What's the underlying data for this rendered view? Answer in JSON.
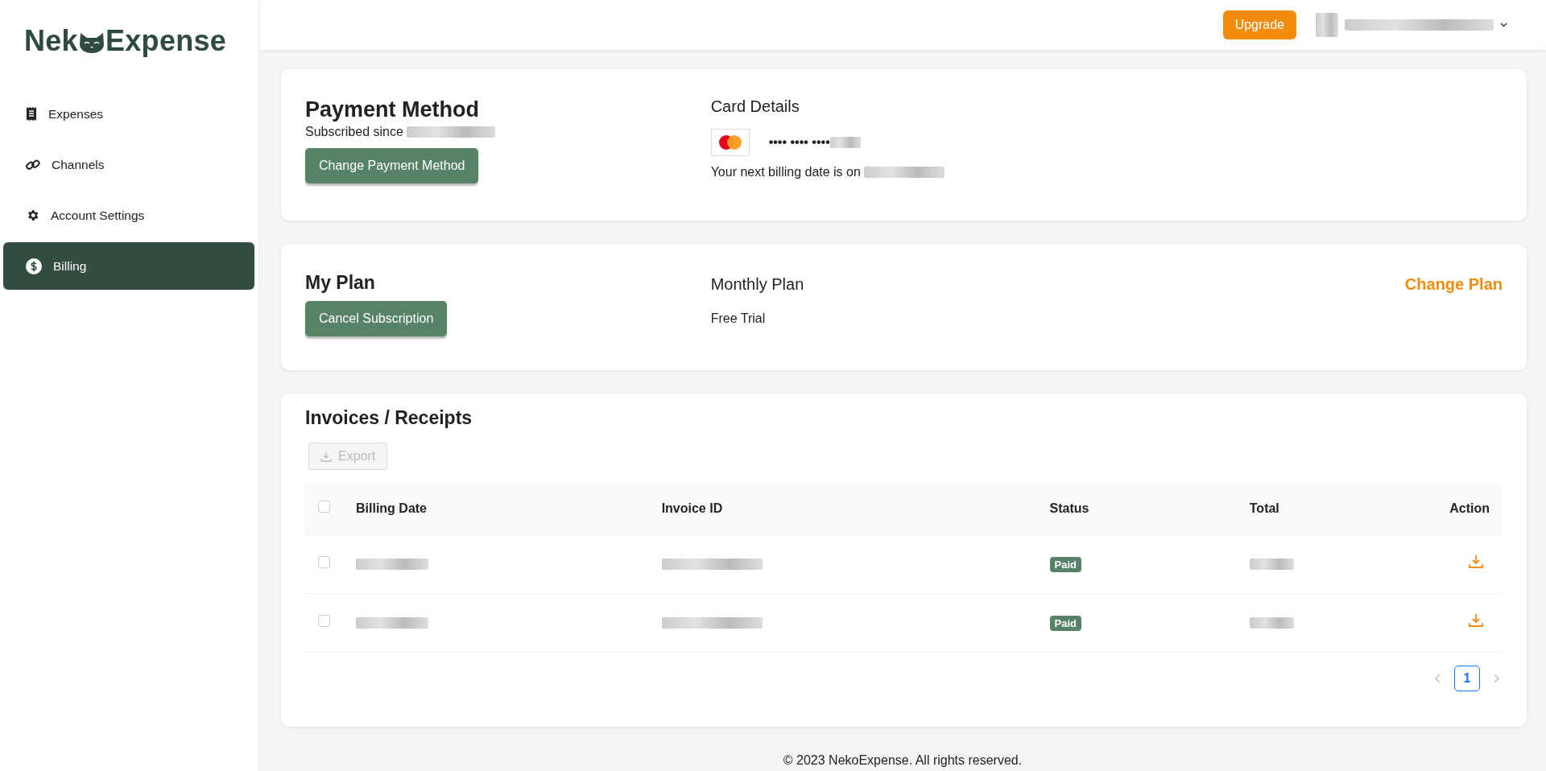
{
  "logo": {
    "before": "Nek",
    "after": "Expense"
  },
  "sidebar": {
    "items": [
      {
        "label": "Expenses",
        "kind": "receipt",
        "selected": false
      },
      {
        "label": "Channels",
        "kind": "link",
        "selected": false
      },
      {
        "label": "Account Settings",
        "kind": "gear",
        "selected": false
      },
      {
        "label": "Billing",
        "kind": "dollar",
        "selected": true
      }
    ]
  },
  "header": {
    "upgrade": "Upgrade"
  },
  "payment": {
    "title": "Payment Method",
    "subscribed": "Subscribed since",
    "button": "Change Payment Method",
    "card_title": "Card Details",
    "card_mask": "•••• •••• ••••",
    "next_billing": "Your next billing date is on"
  },
  "plan": {
    "title": "My Plan",
    "button": "Cancel Subscription",
    "plan_name": "Monthly Plan",
    "plan_status": "Free Trial",
    "change": "Change Plan"
  },
  "invoices": {
    "title": "Invoices / Receipts",
    "export": {
      "label": "Export",
      "disabled": true
    },
    "select_all_checked": false,
    "columns": [
      "Billing Date",
      "Invoice ID",
      "Status",
      "Total",
      "Action"
    ],
    "rows": [
      {
        "checked": false,
        "status": "Paid"
      },
      {
        "checked": false,
        "status": "Paid"
      }
    ],
    "pages": [
      {
        "label": "1",
        "selected": true
      }
    ]
  },
  "footer": "© 2023 NekoExpense. All rights reserved."
}
